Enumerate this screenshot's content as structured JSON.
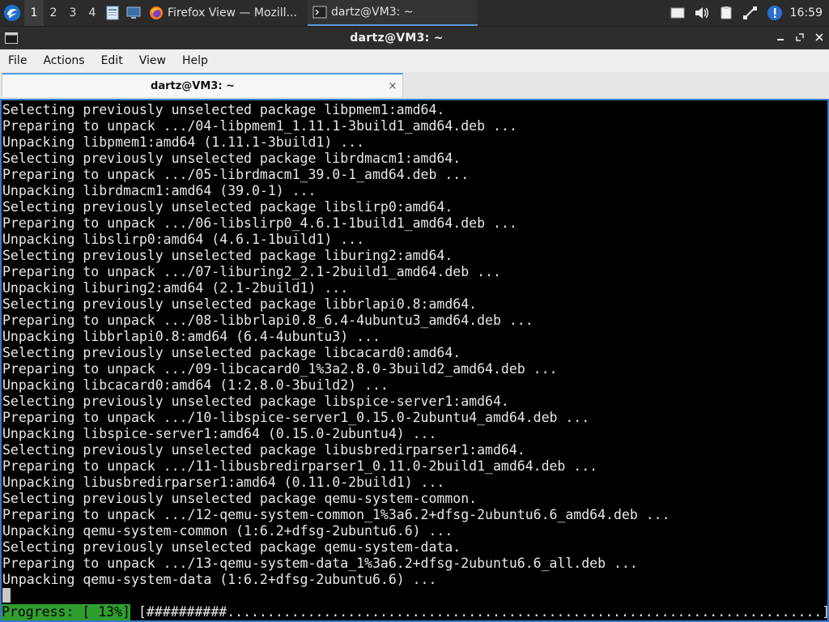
{
  "taskbar": {
    "workspaces": [
      "1",
      "2",
      "3",
      "4"
    ],
    "active_workspace": "1",
    "tasks": [
      {
        "label": "Firefox View — Mozill...",
        "icon": "firefox-icon"
      },
      {
        "label": "dartz@VM3: ~",
        "icon": "terminal-icon"
      }
    ],
    "clock": "16:59"
  },
  "window": {
    "title": "dartz@VM3: ~"
  },
  "menubar": {
    "items": [
      "File",
      "Actions",
      "Edit",
      "View",
      "Help"
    ]
  },
  "tab": {
    "label": "dartz@VM3: ~",
    "close": "×"
  },
  "terminal": {
    "lines": [
      "Selecting previously unselected package libpmem1:amd64.",
      "Preparing to unpack .../04-libpmem1_1.11.1-3build1_amd64.deb ...",
      "Unpacking libpmem1:amd64 (1.11.1-3build1) ...",
      "Selecting previously unselected package librdmacm1:amd64.",
      "Preparing to unpack .../05-librdmacm1_39.0-1_amd64.deb ...",
      "Unpacking librdmacm1:amd64 (39.0-1) ...",
      "Selecting previously unselected package libslirp0:amd64.",
      "Preparing to unpack .../06-libslirp0_4.6.1-1build1_amd64.deb ...",
      "Unpacking libslirp0:amd64 (4.6.1-1build1) ...",
      "Selecting previously unselected package liburing2:amd64.",
      "Preparing to unpack .../07-liburing2_2.1-2build1_amd64.deb ...",
      "Unpacking liburing2:amd64 (2.1-2build1) ...",
      "Selecting previously unselected package libbrlapi0.8:amd64.",
      "Preparing to unpack .../08-libbrlapi0.8_6.4-4ubuntu3_amd64.deb ...",
      "Unpacking libbrlapi0.8:amd64 (6.4-4ubuntu3) ...",
      "Selecting previously unselected package libcacard0:amd64.",
      "Preparing to unpack .../09-libcacard0_1%3a2.8.0-3build2_amd64.deb ...",
      "Unpacking libcacard0:amd64 (1:2.8.0-3build2) ...",
      "Selecting previously unselected package libspice-server1:amd64.",
      "Preparing to unpack .../10-libspice-server1_0.15.0-2ubuntu4_amd64.deb ...",
      "Unpacking libspice-server1:amd64 (0.15.0-2ubuntu4) ...",
      "Selecting previously unselected package libusbredirparser1:amd64.",
      "Preparing to unpack .../11-libusbredirparser1_0.11.0-2build1_amd64.deb ...",
      "Unpacking libusbredirparser1:amd64 (0.11.0-2build1) ...",
      "Selecting previously unselected package qemu-system-common.",
      "Preparing to unpack .../12-qemu-system-common_1%3a6.2+dfsg-2ubuntu6.6_amd64.deb ...",
      "Unpacking qemu-system-common (1:6.2+dfsg-2ubuntu6.6) ...",
      "Selecting previously unselected package qemu-system-data.",
      "Preparing to unpack .../13-qemu-system-data_1%3a6.2+dfsg-2ubuntu6.6_all.deb ...",
      "Unpacking qemu-system-data (1:6.2+dfsg-2ubuntu6.6) ..."
    ],
    "progress_label": "Progress: [ 13%]",
    "progress_bar": "[##########..........................................................................]",
    "progress_percent": 13
  }
}
